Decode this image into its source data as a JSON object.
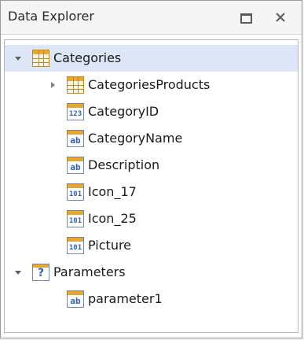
{
  "panel": {
    "title": "Data Explorer"
  },
  "tree": {
    "categories": {
      "label": "Categories",
      "children": [
        {
          "label": "CategoriesProducts"
        },
        {
          "label": "CategoryID",
          "icon_text": "123"
        },
        {
          "label": "CategoryName",
          "icon_text": "ab"
        },
        {
          "label": "Description",
          "icon_text": "ab"
        },
        {
          "label": "Icon_17",
          "icon_text": "101"
        },
        {
          "label": "Icon_25",
          "icon_text": "101"
        },
        {
          "label": "Picture",
          "icon_text": "101"
        }
      ]
    },
    "parameters": {
      "label": "Parameters",
      "icon_text": "?",
      "children": [
        {
          "label": "parameter1",
          "icon_text": "ab"
        }
      ]
    }
  },
  "colors": {
    "selection": "#dce6f6",
    "icon_accent": "#e8a830",
    "icon_text": "#2f63b0"
  }
}
